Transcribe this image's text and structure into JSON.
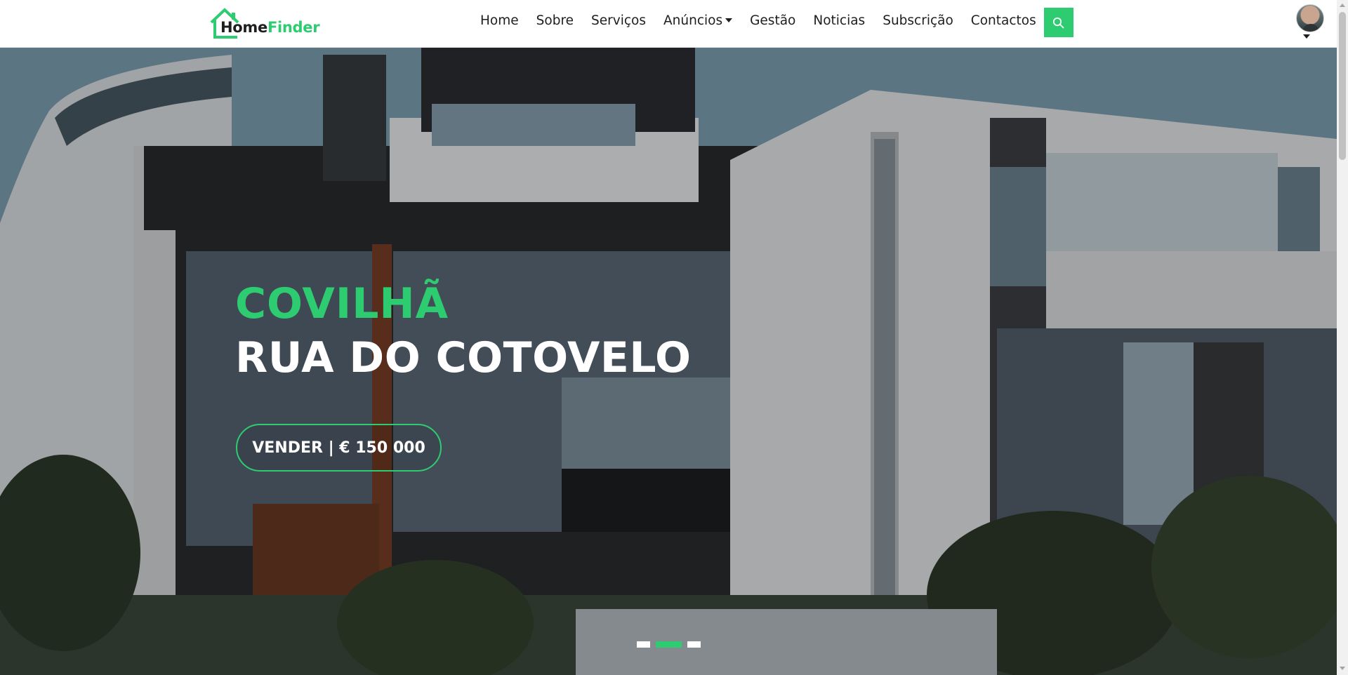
{
  "brand": {
    "part1": "Home",
    "part2": "Finder",
    "accent": "#2ecc71"
  },
  "nav": {
    "items": [
      {
        "label": "Home"
      },
      {
        "label": "Sobre"
      },
      {
        "label": "Serviços"
      },
      {
        "label": "Anúncios",
        "has_dropdown": true
      },
      {
        "label": "Gestão"
      },
      {
        "label": "Noticias"
      },
      {
        "label": "Subscrição"
      },
      {
        "label": "Contactos"
      }
    ],
    "search_icon": "search-icon",
    "user_icon": "avatar"
  },
  "hero": {
    "city": "COVILHÃ",
    "street": "RUA DO COTOVELO",
    "cta": "VENDER | € 150 000",
    "slides": {
      "count": 3,
      "active_index": 1
    }
  },
  "colors": {
    "accent": "#2ecc71",
    "text": "#1e1e1e",
    "white": "#ffffff"
  }
}
